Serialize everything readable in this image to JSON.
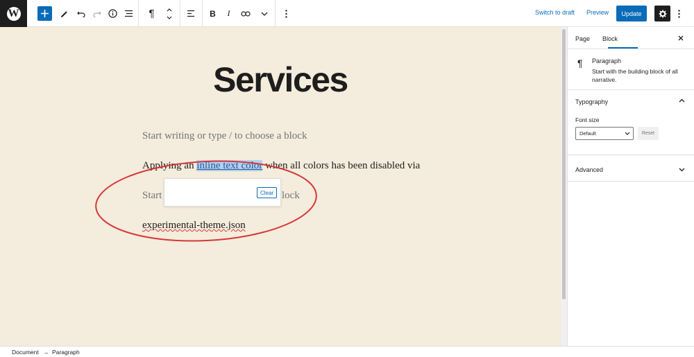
{
  "toolbar": {
    "logo": "W",
    "add_icon": "plus-icon",
    "switch_to_draft": "Switch to draft",
    "preview": "Preview",
    "update": "Update",
    "paragraph_icon": "¶",
    "bold": "B",
    "italic": "I"
  },
  "editor": {
    "title": "Services",
    "placeholder_1": "Start writing or type / to choose a block",
    "para_before": "Applying an ",
    "para_highlight": "inline text color",
    "para_after": " when all colors has been disabled via",
    "placeholder_2_start": "Start",
    "placeholder_2_end": "lock",
    "para_last": "experimental-theme.json",
    "popover_clear": "Clear"
  },
  "sidebar": {
    "tab_page": "Page",
    "tab_block": "Block",
    "block_name": "Paragraph",
    "block_desc": "Start with the building block of all narrative.",
    "typography": "Typography",
    "font_size_label": "Font size",
    "font_size_value": "Default",
    "reset": "Reset",
    "advanced": "Advanced"
  },
  "footer": {
    "crumb_1": "Document",
    "crumb_sep": "→",
    "crumb_2": "Paragraph"
  },
  "colors": {
    "accent": "#0a6bb8",
    "canvas": "#f4ecdc",
    "annotation": "#d63638"
  }
}
